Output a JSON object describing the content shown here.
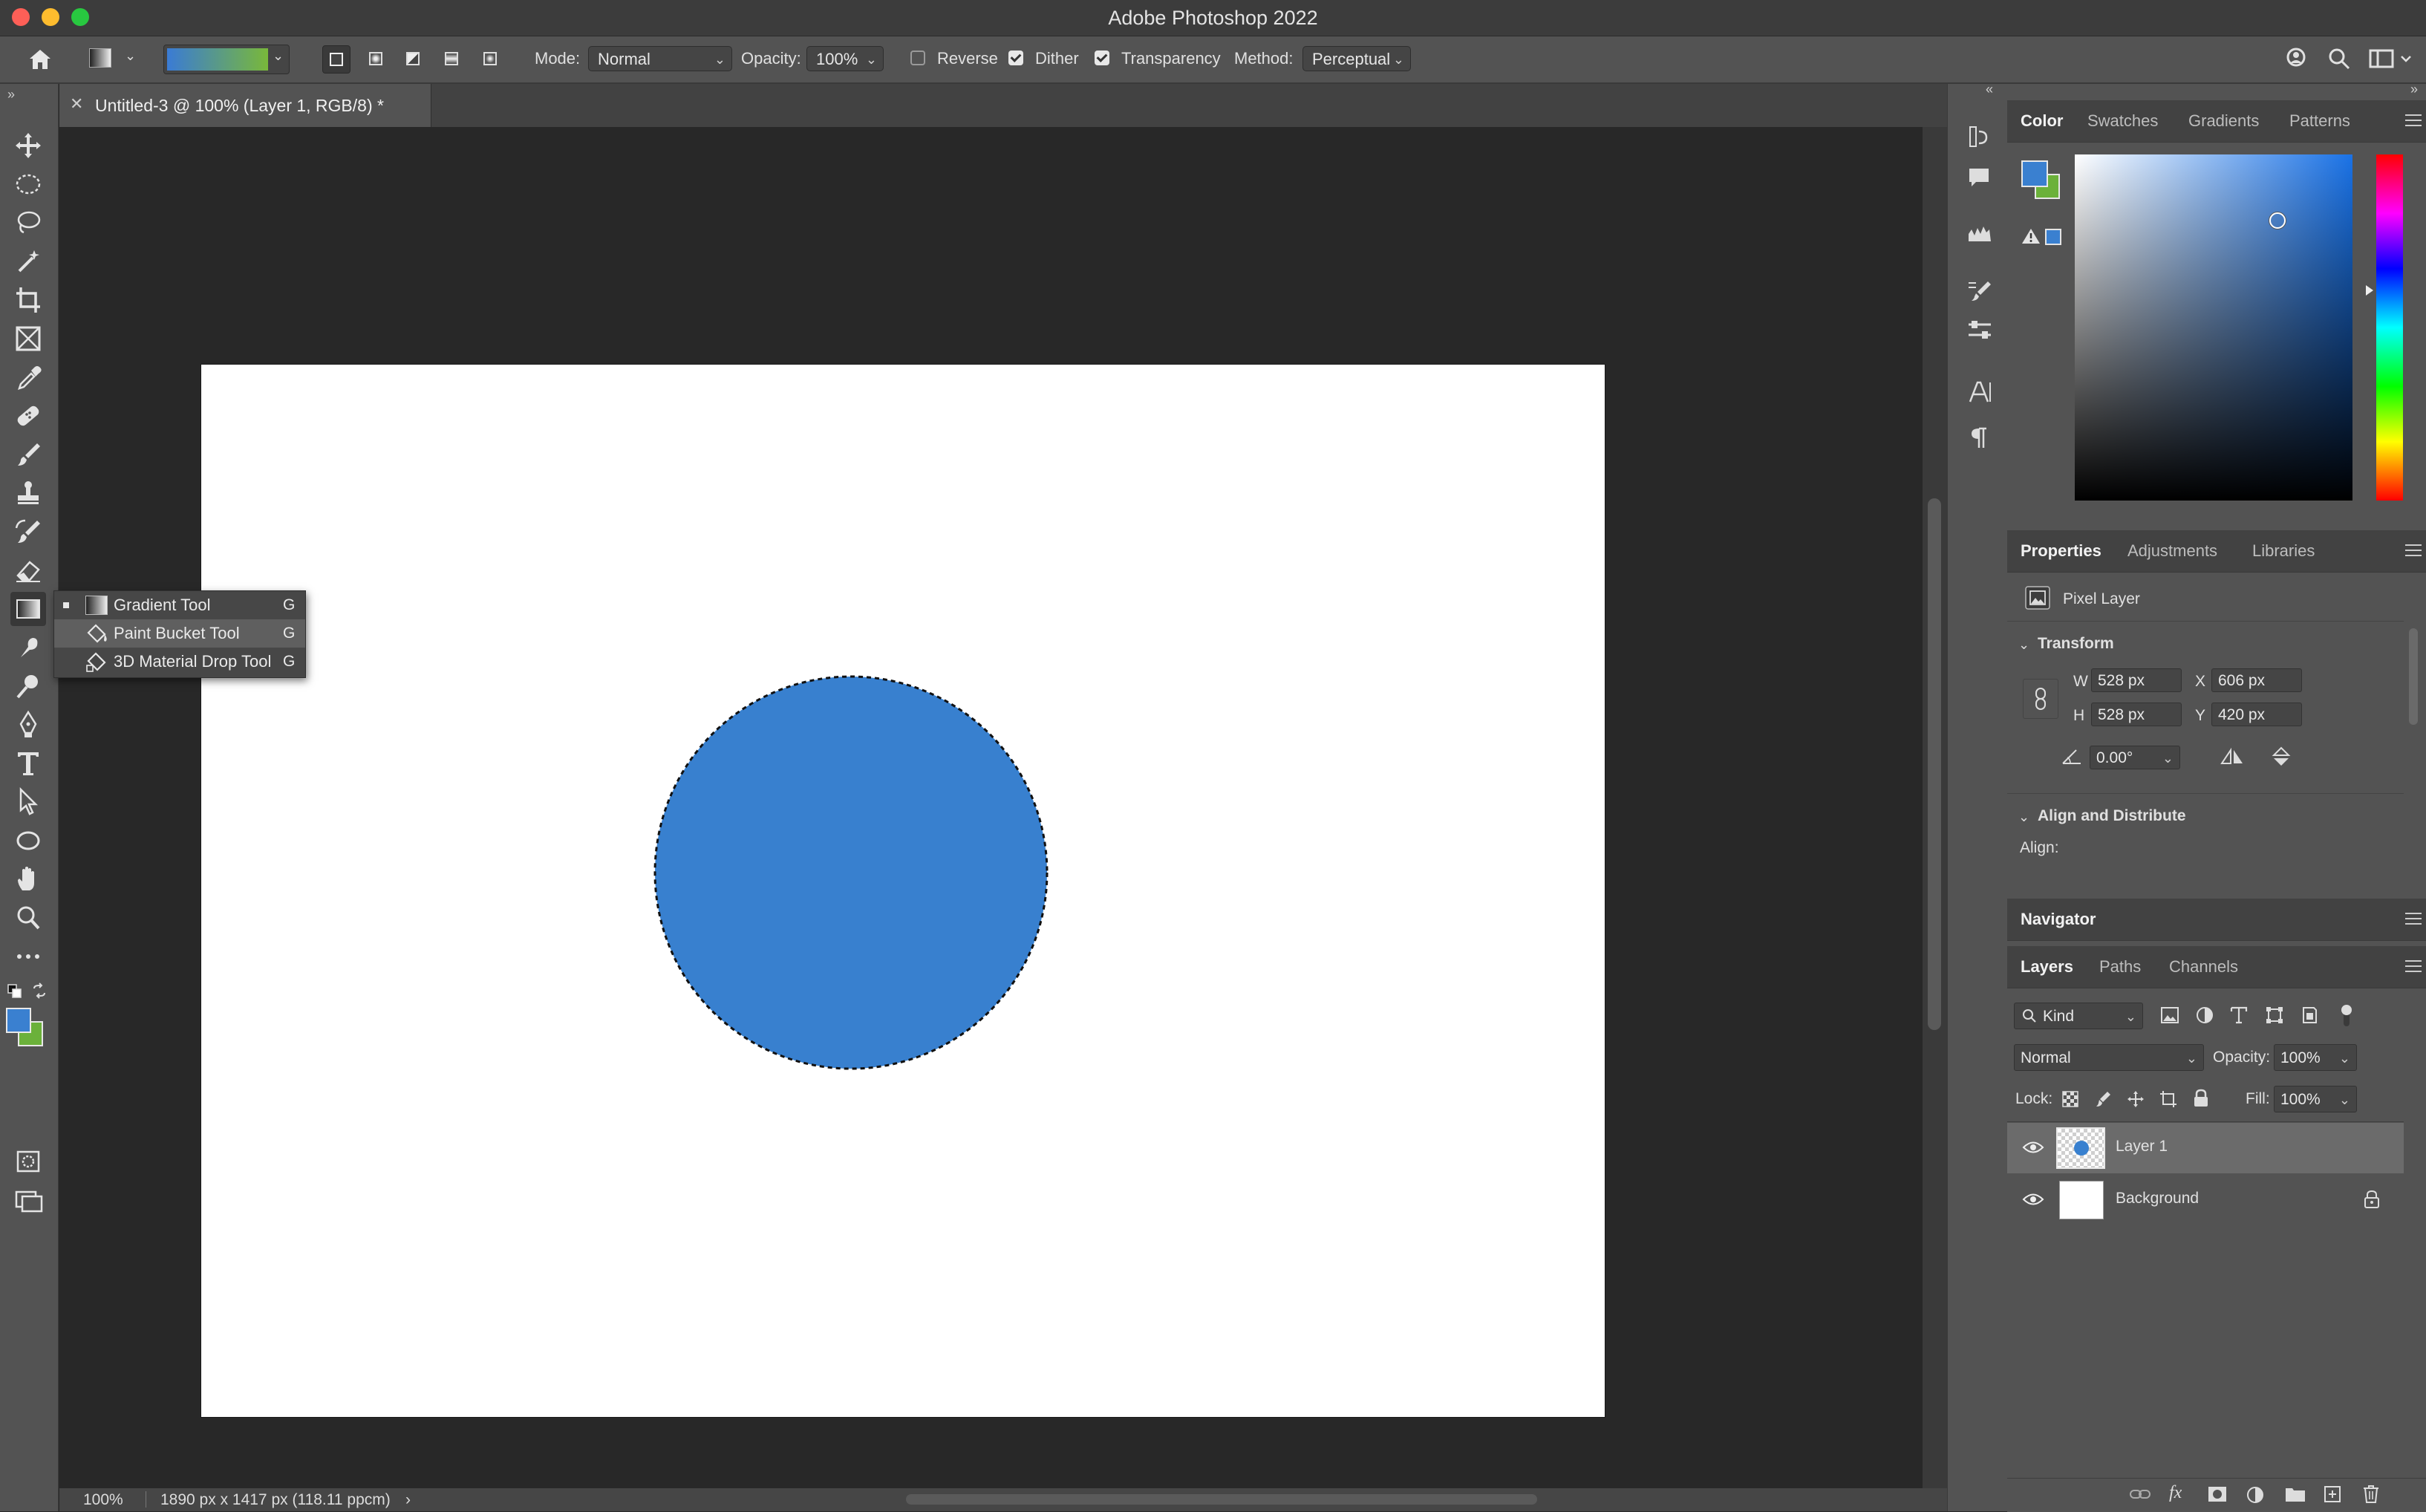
{
  "window": {
    "title": "Adobe Photoshop 2022"
  },
  "options_bar": {
    "mode_label": "Mode:",
    "mode_value": "Normal",
    "opacity_label": "Opacity:",
    "opacity_value": "100%",
    "reverse_label": "Reverse",
    "reverse_checked": false,
    "dither_label": "Dither",
    "dither_checked": true,
    "transparency_label": "Transparency",
    "transparency_checked": true,
    "method_label": "Method:",
    "method_value": "Perceptual",
    "gradient_colors": [
      "#3a7bd5",
      "#79b83a"
    ]
  },
  "document": {
    "tab_title": "Untitled-3 @ 100% (Layer 1, RGB/8) *",
    "zoom": "100%",
    "dimensions": "1890 px x 1417 px (118.11 ppcm)",
    "fill_color": "#3880cf"
  },
  "tool_flyout": {
    "items": [
      {
        "label": "Gradient Tool",
        "key": "G"
      },
      {
        "label": "Paint Bucket Tool",
        "key": "G"
      },
      {
        "label": "3D Material Drop Tool",
        "key": "G"
      }
    ]
  },
  "color_panel": {
    "tabs": [
      "Color",
      "Swatches",
      "Gradients",
      "Patterns"
    ],
    "foreground": "#3a80d0",
    "background": "#6bb13a"
  },
  "properties_panel": {
    "tabs": [
      "Properties",
      "Adjustments",
      "Libraries"
    ],
    "layer_type": "Pixel Layer",
    "transform_title": "Transform",
    "w_label": "W",
    "w_value": "528 px",
    "x_label": "X",
    "x_value": "606 px",
    "h_label": "H",
    "h_value": "528 px",
    "y_label": "Y",
    "y_value": "420 px",
    "angle_value": "0.00°",
    "align_title": "Align and Distribute",
    "align_label": "Align:"
  },
  "navigator_panel": {
    "title": "Navigator"
  },
  "layers_panel": {
    "tabs": [
      "Layers",
      "Paths",
      "Channels"
    ],
    "filter_value": "Kind",
    "blend_mode": "Normal",
    "opacity_label": "Opacity:",
    "opacity_value": "100%",
    "lock_label": "Lock:",
    "fill_label": "Fill:",
    "fill_value": "100%",
    "layers": [
      {
        "name": "Layer 1",
        "selected": true,
        "visible": true
      },
      {
        "name": "Background",
        "selected": false,
        "visible": true,
        "locked": true
      }
    ]
  }
}
